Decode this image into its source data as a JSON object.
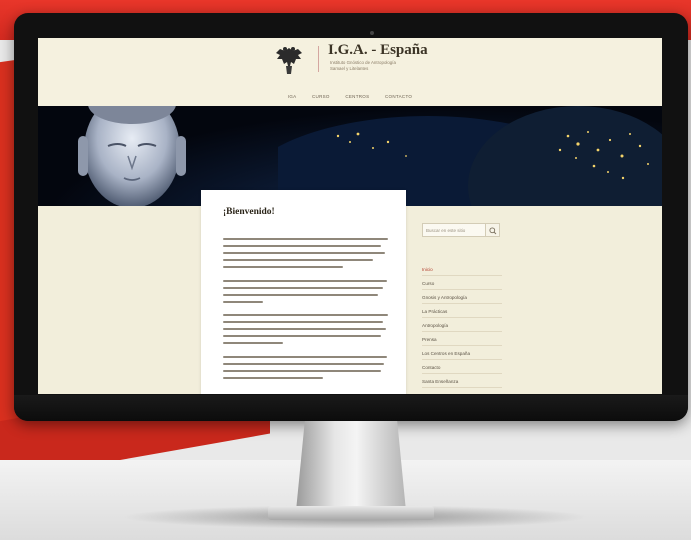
{
  "site": {
    "title": "I.G.A. - España",
    "subtitle_line1": "Instituto Gnóstico de Antropología",
    "subtitle_line2": "Samael y Litelantes"
  },
  "nav": {
    "items": [
      {
        "label": "IGA"
      },
      {
        "label": "CURSO"
      },
      {
        "label": "CENTROS"
      },
      {
        "label": "CONTACTO"
      }
    ]
  },
  "post": {
    "title": "¡Bienvenido!"
  },
  "sidebar": {
    "search_placeholder": "Buscar en este sitio",
    "items": [
      {
        "label": "Inicio"
      },
      {
        "label": "Curso"
      },
      {
        "label": "Gnosis y Antropología"
      },
      {
        "label": "La Prácticas"
      },
      {
        "label": "Antropología"
      },
      {
        "label": "Prensa"
      },
      {
        "label": "Los Centros en España"
      },
      {
        "label": "Contacto"
      },
      {
        "label": "Santa Enseñanza"
      }
    ]
  },
  "colors": {
    "accent_red": "#d42a20",
    "page_bg": "#f2eedb",
    "active_link": "#b23d2c"
  },
  "icons": {
    "logo": "double-headed-eagle-icon",
    "search": "search-icon"
  }
}
